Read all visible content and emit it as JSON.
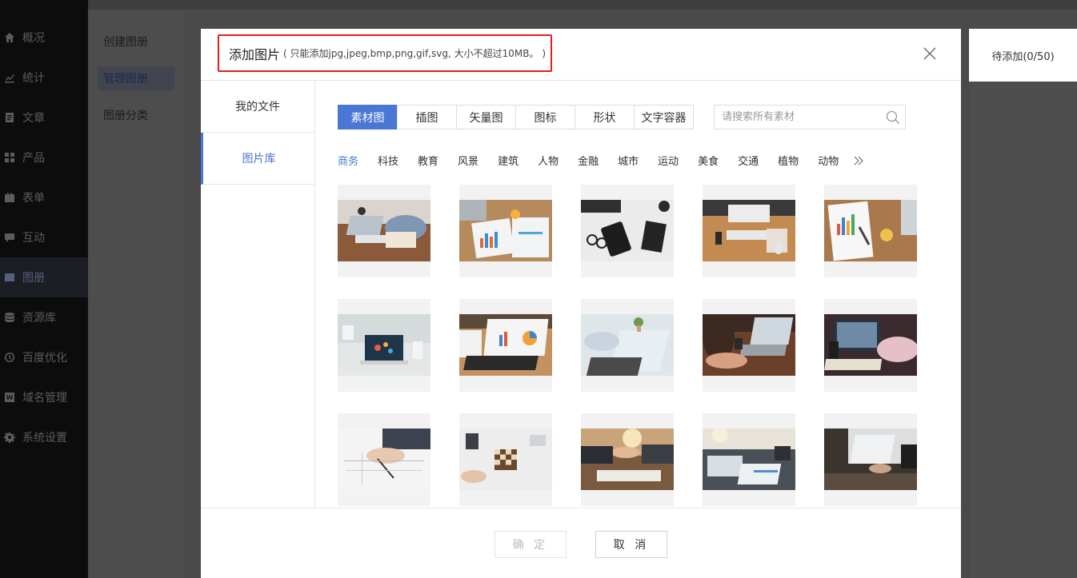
{
  "sidebar": {
    "items": [
      {
        "label": "概况",
        "icon": "home-icon"
      },
      {
        "label": "统计",
        "icon": "chart-icon"
      },
      {
        "label": "文章",
        "icon": "article-icon"
      },
      {
        "label": "产品",
        "icon": "grid-icon"
      },
      {
        "label": "表单",
        "icon": "calendar-icon"
      },
      {
        "label": "互动",
        "icon": "chat-icon"
      },
      {
        "label": "图册",
        "icon": "album-icon"
      },
      {
        "label": "资源库",
        "icon": "database-icon"
      },
      {
        "label": "百度优化",
        "icon": "clock-icon"
      },
      {
        "label": "域名管理",
        "icon": "w-icon"
      },
      {
        "label": "系统设置",
        "icon": "gear-icon"
      }
    ]
  },
  "subnav": {
    "items": [
      "创建图册",
      "管理图册",
      "图册分类"
    ]
  },
  "right_panel": {
    "pending_label": "待添加(0/50)"
  },
  "modal": {
    "title": "添加图片",
    "note": "( 只能添加jpg,jpeg,bmp,png,gif,svg, 大小不超过10MB。 )",
    "left_tabs": [
      "我的文件",
      "图片库"
    ],
    "type_tabs": [
      "素材图",
      "插图",
      "矢量图",
      "图标",
      "形状",
      "文字容器"
    ],
    "search_placeholder": "请搜索所有素材",
    "categories": [
      "商务",
      "科技",
      "教育",
      "风景",
      "建筑",
      "人物",
      "金融",
      "城市",
      "运动",
      "美食",
      "交通",
      "植物",
      "动物"
    ],
    "ok_label": "确 定",
    "cancel_label": "取 消"
  },
  "colors": {
    "accent": "#4a76d6",
    "highlight_border": "#e61e1e"
  }
}
